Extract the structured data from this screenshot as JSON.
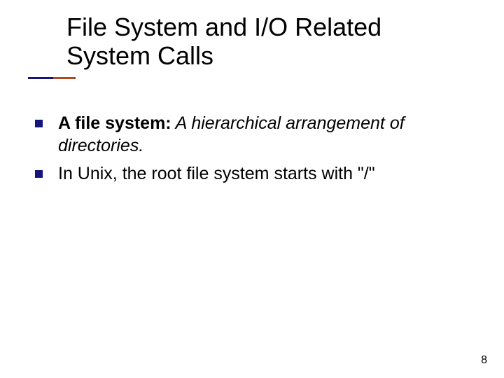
{
  "title": "File System and I/O Related System Calls",
  "bullets": [
    {
      "bold": "A file system:",
      "italic": " A hierarchical arrangement of directories.",
      "plain": ""
    },
    {
      "bold": "",
      "italic": "",
      "plain": "In Unix, the root file system starts with \"/\""
    }
  ],
  "page_number": "8"
}
